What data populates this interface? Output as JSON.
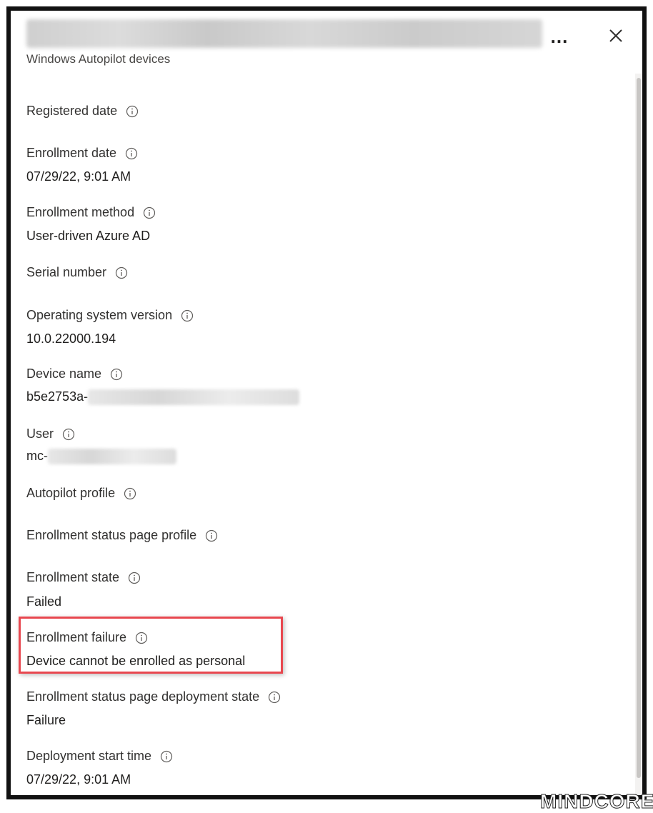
{
  "header": {
    "subtitle": "Windows Autopilot devices",
    "more_label": "...",
    "close_icon": "close-icon"
  },
  "fields": {
    "registered_date": {
      "label": "Registered date"
    },
    "enrollment_date": {
      "label": "Enrollment date",
      "value": "07/29/22, 9:01 AM"
    },
    "enrollment_method": {
      "label": "Enrollment method",
      "value": "User-driven Azure AD"
    },
    "serial_number": {
      "label": "Serial number"
    },
    "os_version": {
      "label": "Operating system version",
      "value": "10.0.22000.194"
    },
    "device_name": {
      "label": "Device name",
      "value_visible": "b5e2753a-"
    },
    "user": {
      "label": "User",
      "value_visible": "mc-"
    },
    "autopilot_profile": {
      "label": "Autopilot profile"
    },
    "esp_profile": {
      "label": "Enrollment status page profile"
    },
    "enrollment_state": {
      "label": "Enrollment state",
      "value": "Failed"
    },
    "enrollment_failure": {
      "label": "Enrollment failure",
      "value": "Device cannot be enrolled as personal"
    },
    "esp_deployment_state": {
      "label": "Enrollment status page deployment state",
      "value": "Failure"
    },
    "deployment_start_time": {
      "label": "Deployment start time",
      "value": "07/29/22, 9:01 AM"
    }
  },
  "watermark": "MINDCORE",
  "colors": {
    "highlight_border": "#e8474f",
    "text": "#323130",
    "frame": "#111111"
  }
}
